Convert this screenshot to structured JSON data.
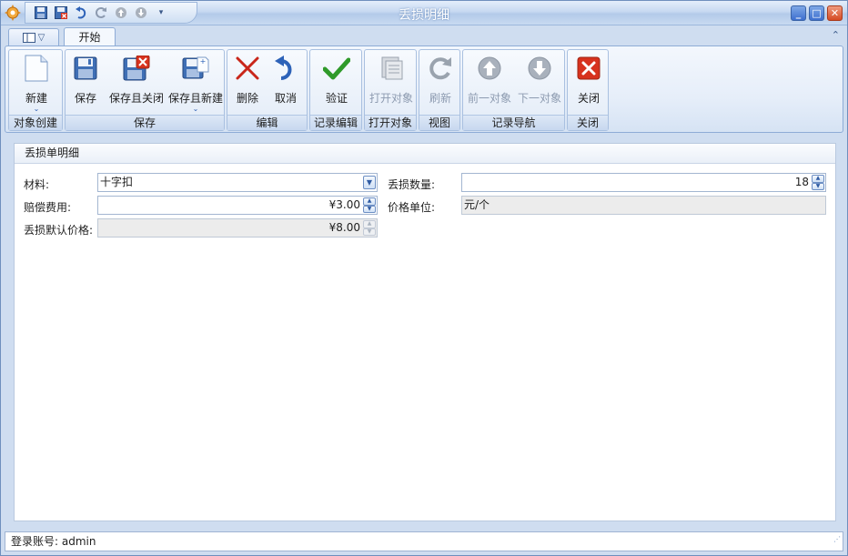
{
  "window": {
    "title": "丢损明细"
  },
  "tabs": {
    "home_label": "开始"
  },
  "ribbon": {
    "groups": [
      {
        "label": "对象创建",
        "buttons": [
          {
            "label": "新建",
            "icon": "new-document-icon"
          }
        ]
      },
      {
        "label": "保存",
        "buttons": [
          {
            "label": "保存",
            "icon": "save-icon"
          },
          {
            "label": "保存且关闭",
            "icon": "save-close-icon"
          },
          {
            "label": "保存且新建",
            "icon": "save-new-icon"
          }
        ]
      },
      {
        "label": "编辑",
        "buttons": [
          {
            "label": "删除",
            "icon": "delete-icon"
          },
          {
            "label": "取消",
            "icon": "undo-icon"
          }
        ]
      },
      {
        "label": "记录编辑",
        "buttons": [
          {
            "label": "验证",
            "icon": "check-icon"
          }
        ]
      },
      {
        "label": "打开对象",
        "buttons": [
          {
            "label": "打开对象",
            "icon": "open-object-icon"
          }
        ]
      },
      {
        "label": "视图",
        "buttons": [
          {
            "label": "刷新",
            "icon": "refresh-icon"
          }
        ]
      },
      {
        "label": "记录导航",
        "buttons": [
          {
            "label": "前一对象",
            "icon": "previous-icon"
          },
          {
            "label": "下一对象",
            "icon": "next-icon"
          }
        ]
      },
      {
        "label": "关闭",
        "buttons": [
          {
            "label": "关闭",
            "icon": "close-red-icon"
          }
        ]
      }
    ]
  },
  "form": {
    "section_title": "丢损单明细",
    "material_label": "材料:",
    "material_value": "十字扣",
    "quantity_label": "丢损数量:",
    "quantity_value": "18",
    "compensation_label": "赔偿费用:",
    "compensation_value": "¥3.00",
    "unit_label": "价格单位:",
    "unit_value": "元/个",
    "default_price_label": "丢损默认价格:",
    "default_price_value": "¥8.00"
  },
  "status": {
    "text": "登录账号: admin"
  }
}
